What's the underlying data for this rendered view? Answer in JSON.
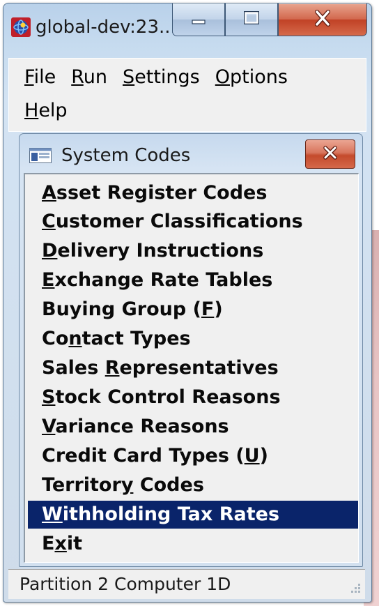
{
  "window": {
    "title": "global-dev:23...",
    "minimize_icon": "minimize-icon",
    "maximize_icon": "maximize-icon",
    "close_icon": "close-icon",
    "app_icon": "globe-app-icon"
  },
  "menubar": {
    "items": [
      {
        "mnemonic": "F",
        "rest": "ile"
      },
      {
        "mnemonic": "R",
        "rest": "un"
      },
      {
        "mnemonic": "S",
        "rest": "ettings"
      },
      {
        "mnemonic": "O",
        "rest": "ptions"
      },
      {
        "mnemonic": "H",
        "rest": "elp"
      }
    ]
  },
  "system_codes": {
    "title": "System Codes",
    "icon": "window-icon",
    "close_icon": "close-icon",
    "items": [
      {
        "pre": "",
        "mn": "A",
        "post": "sset Register Codes",
        "selected": false
      },
      {
        "pre": "",
        "mn": "C",
        "post": "ustomer Classifications",
        "selected": false
      },
      {
        "pre": "",
        "mn": "D",
        "post": "elivery Instructions",
        "selected": false
      },
      {
        "pre": "",
        "mn": "E",
        "post": "xchange Rate Tables",
        "selected": false
      },
      {
        "pre": "Buying Group (",
        "mn": "F",
        "post": ")",
        "selected": false
      },
      {
        "pre": "Co",
        "mn": "n",
        "post": "tact Types",
        "selected": false
      },
      {
        "pre": "Sales ",
        "mn": "R",
        "post": "epresentatives",
        "selected": false
      },
      {
        "pre": "",
        "mn": "S",
        "post": "tock Control Reasons",
        "selected": false
      },
      {
        "pre": "",
        "mn": "V",
        "post": "ariance Reasons",
        "selected": false
      },
      {
        "pre": "Credit Card Types (",
        "mn": "U",
        "post": ")",
        "selected": false
      },
      {
        "pre": "Territor",
        "mn": "y",
        "post": " Codes",
        "selected": false
      },
      {
        "pre": "",
        "mn": "W",
        "post": "ithholding Tax Rates",
        "selected": true
      },
      {
        "pre": "E",
        "mn": "x",
        "post": "it",
        "selected": false
      }
    ]
  },
  "statusbar": {
    "text": "Partition 2 Computer 1D",
    "grip_icon": "size-grip-icon"
  },
  "colors": {
    "selection_bg": "#0a246a",
    "selection_fg": "#ffffff",
    "close_red": "#c14226"
  }
}
